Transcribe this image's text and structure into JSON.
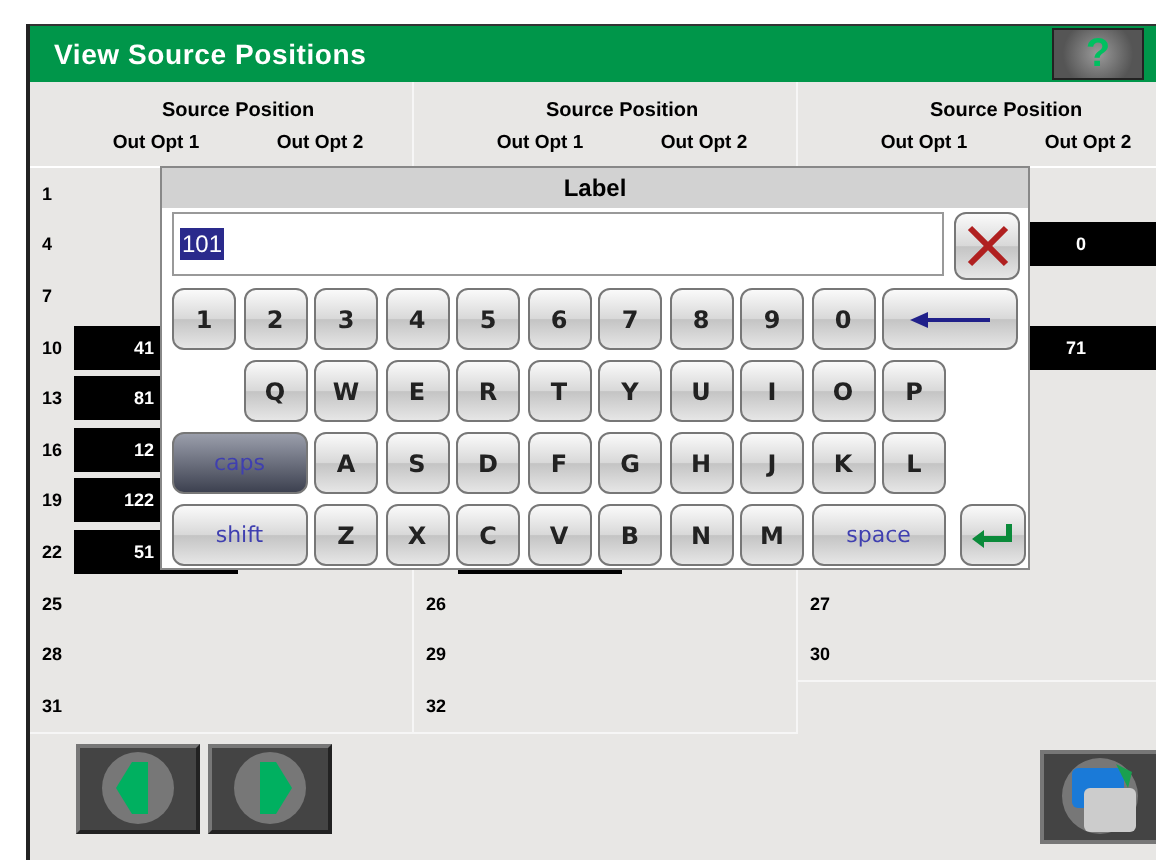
{
  "window": {
    "title": "View Source Positions",
    "help_label": "?"
  },
  "groups": [
    {
      "heading": "Source Position",
      "subheadings": [
        "Out Opt 1",
        "Out Opt 2"
      ],
      "rows": [
        {
          "number": "1"
        },
        {
          "number": "4"
        },
        {
          "number": "7"
        },
        {
          "number": "10",
          "cells": [
            {
              "filled": true,
              "value": "41"
            },
            {
              "filled": false
            }
          ]
        },
        {
          "number": "13",
          "cells": [
            {
              "filled": true,
              "value": "81"
            },
            {
              "filled": false
            }
          ]
        },
        {
          "number": "16",
          "cells": [
            {
              "filled": true,
              "value": "12"
            },
            {
              "filled": false
            }
          ]
        },
        {
          "number": "19",
          "cells": [
            {
              "filled": true,
              "value": "122"
            },
            {
              "filled": false
            }
          ]
        },
        {
          "number": "22",
          "cells": [
            {
              "filled": true,
              "value": "51"
            },
            {
              "filled": false
            }
          ]
        },
        {
          "number": "25"
        },
        {
          "number": "28"
        },
        {
          "number": "31"
        }
      ]
    },
    {
      "heading": "Source Position",
      "subheadings": [
        "Out Opt 1",
        "Out Opt 2"
      ],
      "rows": [
        {},
        {},
        {},
        {},
        {},
        {},
        {},
        {
          "cells": [
            {
              "filled": true
            },
            {
              "filled": false
            }
          ]
        },
        {
          "number": "26"
        },
        {
          "number": "29"
        },
        {
          "number": "32"
        }
      ]
    },
    {
      "heading": "Source Position",
      "subheadings": [
        "Out Opt 1",
        "Out Opt 2"
      ],
      "rows": [
        {},
        {
          "cells": [
            {
              "filled": false
            },
            {
              "filled": true,
              "value": "0"
            }
          ]
        },
        {},
        {
          "cells": [
            {
              "filled": false
            },
            {
              "filled": true,
              "value": "71"
            }
          ]
        },
        {},
        {},
        {},
        {},
        {
          "number": "27"
        },
        {
          "number": "30"
        }
      ]
    }
  ],
  "keyboard": {
    "title": "Label",
    "input": {
      "value": "101",
      "text_selected": true
    },
    "key_rows": [
      {
        "keys": [
          {
            "kind": "char",
            "label": "1"
          },
          {
            "kind": "char",
            "label": "2"
          },
          {
            "kind": "char",
            "label": "3"
          },
          {
            "kind": "char",
            "label": "4"
          },
          {
            "kind": "char",
            "label": "5"
          },
          {
            "kind": "char",
            "label": "6"
          },
          {
            "kind": "char",
            "label": "7"
          },
          {
            "kind": "char",
            "label": "8"
          },
          {
            "kind": "char",
            "label": "9"
          },
          {
            "kind": "char",
            "label": "0"
          },
          {
            "kind": "backspace"
          }
        ]
      },
      {
        "keys": [
          {
            "kind": "char",
            "label": "Q"
          },
          {
            "kind": "char",
            "label": "W"
          },
          {
            "kind": "char",
            "label": "E"
          },
          {
            "kind": "char",
            "label": "R"
          },
          {
            "kind": "char",
            "label": "T"
          },
          {
            "kind": "char",
            "label": "Y"
          },
          {
            "kind": "char",
            "label": "U"
          },
          {
            "kind": "char",
            "label": "I"
          },
          {
            "kind": "char",
            "label": "O"
          },
          {
            "kind": "char",
            "label": "P"
          }
        ]
      },
      {
        "keys": [
          {
            "kind": "toggle",
            "label": "caps",
            "on": true
          },
          {
            "kind": "char",
            "label": "A"
          },
          {
            "kind": "char",
            "label": "S"
          },
          {
            "kind": "char",
            "label": "D"
          },
          {
            "kind": "char",
            "label": "F"
          },
          {
            "kind": "char",
            "label": "G"
          },
          {
            "kind": "char",
            "label": "H"
          },
          {
            "kind": "char",
            "label": "J"
          },
          {
            "kind": "char",
            "label": "K"
          },
          {
            "kind": "char",
            "label": "L"
          }
        ]
      },
      {
        "keys": [
          {
            "kind": "toggle",
            "label": "shift",
            "on": false
          },
          {
            "kind": "char",
            "label": "Z"
          },
          {
            "kind": "char",
            "label": "X"
          },
          {
            "kind": "char",
            "label": "C"
          },
          {
            "kind": "char",
            "label": "V"
          },
          {
            "kind": "char",
            "label": "B"
          },
          {
            "kind": "char",
            "label": "N"
          },
          {
            "kind": "char",
            "label": "M"
          },
          {
            "kind": "space",
            "label": "space"
          },
          {
            "kind": "enter"
          }
        ]
      }
    ]
  }
}
